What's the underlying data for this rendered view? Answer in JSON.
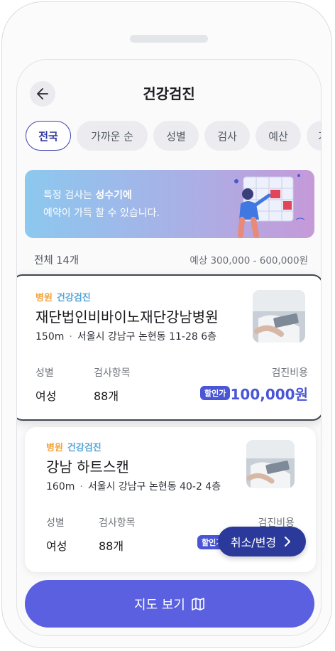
{
  "header": {
    "title": "건강검진"
  },
  "chips": [
    {
      "label": "전국",
      "active": true
    },
    {
      "label": "가까운 순"
    },
    {
      "label": "성별"
    },
    {
      "label": "검사"
    },
    {
      "label": "예산"
    },
    {
      "label": "기"
    }
  ],
  "banner": {
    "line1_prefix": "특정 검사는 ",
    "line1_bold": "성수기에",
    "line2": "예약이 가득 찰 수 있습니다."
  },
  "summary": {
    "count": "전체 14개",
    "price_range": "예상 300,000 - 600,000원"
  },
  "cards": [
    {
      "tag_type": "병원",
      "tag_category": "건강검진",
      "name": "재단법인비바이노재단강남병원",
      "distance": "150m",
      "separator": "·",
      "address": "서울시 강남구 논현동 11-28 6층",
      "gender_label": "성별",
      "gender": "여성",
      "items_label": "검사항목",
      "items": "88개",
      "cost_label": "검진비용",
      "discount_badge": "할인가",
      "price": "100,000원"
    },
    {
      "tag_type": "병원",
      "tag_category": "건강검진",
      "name": "강남 하트스캔",
      "distance": "160m",
      "separator": "·",
      "address": "서울시 강남구 논현동 40-2 4층",
      "gender_label": "성별",
      "gender": "여성",
      "items_label": "검사항목",
      "items": "88개",
      "cost_label": "검진비용",
      "discount_badge": "할인가"
    }
  ],
  "fab": {
    "label": "취소/변경"
  },
  "map_button": {
    "label": "지도 보기"
  },
  "colors": {
    "accent": "#4a56d6",
    "primary_button": "#5a60e0",
    "fab": "#2b3a9a",
    "tag_orange": "#f2a33a",
    "tag_blue": "#54a4d8"
  },
  "icons": {
    "back": "arrow-left-icon",
    "map": "map-icon",
    "chevron": "chevron-right-icon"
  }
}
